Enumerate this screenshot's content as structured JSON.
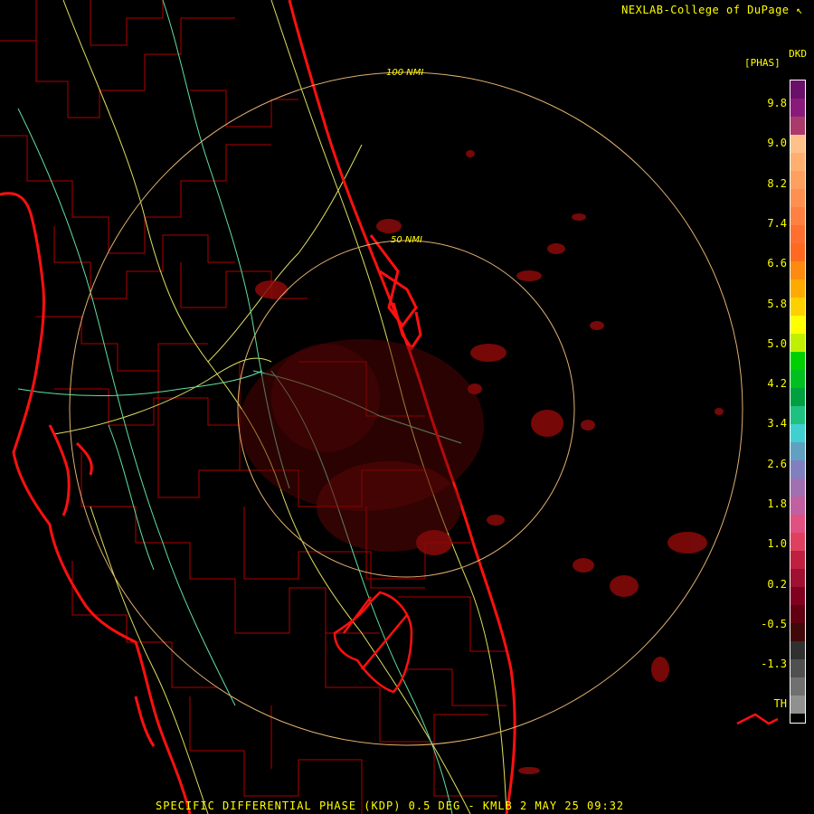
{
  "header": {
    "credit": "NEXLAB-College of DuPage",
    "logo_icon": "nexlab-mark-icon"
  },
  "legend": {
    "product_short": "DKD",
    "product_units": "[PHAS]",
    "labels": [
      "9.8",
      "9.0",
      "8.2",
      "7.4",
      "6.6",
      "5.8",
      "5.0",
      "4.2",
      "3.4",
      "2.6",
      "1.8",
      "1.0",
      "0.2",
      "-0.5",
      "-1.3",
      "TH"
    ],
    "colors": [
      "#6a0f6a",
      "#8a1a7a",
      "#aa3a6a",
      "#ffc08a",
      "#ffb070",
      "#ffa060",
      "#ff9050",
      "#ff8040",
      "#ff7030",
      "#ff6a20",
      "#ff8a10",
      "#ffaa00",
      "#ffd000",
      "#ffff00",
      "#c0f000",
      "#00d000",
      "#00c020",
      "#00a040",
      "#20c080",
      "#40d0d0",
      "#60a0c0",
      "#8080c0",
      "#a070b0",
      "#c060a0",
      "#e05080",
      "#e04060",
      "#c02040",
      "#a01030",
      "#800020",
      "#600010",
      "#400808",
      "#303030",
      "#505050",
      "#707070",
      "#909090"
    ]
  },
  "map": {
    "ring_labels": [
      "100 NMI",
      "50 NMI"
    ]
  },
  "footer": {
    "caption": "SPECIFIC DIFFERENTIAL PHASE (KDP) 0.5 DEG - KMLB 2 MAY 25 09:32"
  }
}
